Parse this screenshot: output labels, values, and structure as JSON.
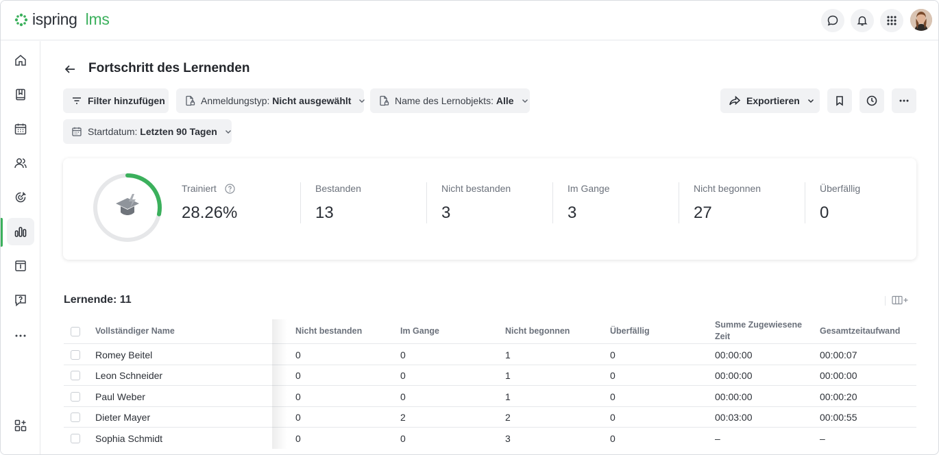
{
  "app": {
    "logo_word1": "ispring",
    "logo_word2": "lms",
    "brand_color": "#3bb05c"
  },
  "header_icons": [
    "chat-icon",
    "bell-icon",
    "apps-grid-icon"
  ],
  "sidebar": {
    "items": [
      {
        "name": "home-icon"
      },
      {
        "name": "book-icon"
      },
      {
        "name": "calendar-icon"
      },
      {
        "name": "users-icon"
      },
      {
        "name": "target-icon"
      },
      {
        "name": "reports-icon",
        "active": true
      },
      {
        "name": "info-calendar-icon"
      },
      {
        "name": "help-icon"
      },
      {
        "name": "more-icon"
      },
      {
        "name": "add-widget-icon"
      }
    ]
  },
  "page": {
    "title": "Fortschritt des Lernenden"
  },
  "filters": {
    "add_filter": "Filter hinzufügen",
    "enrollment_label": "Anmeldungstyp:",
    "enrollment_value": "Nicht ausgewählt",
    "object_label": "Name des Lernobjekts:",
    "object_value": "Alle",
    "start_label": "Startdatum:",
    "start_value": "Letzten 90 Tagen",
    "export": "Exportieren"
  },
  "stats": {
    "progress_fraction": 0.2826,
    "trained_label": "Trainiert",
    "trained_value": "28.26%",
    "items": [
      {
        "label": "Bestanden",
        "value": "13"
      },
      {
        "label": "Nicht bestanden",
        "value": "3"
      },
      {
        "label": "Im Gange",
        "value": "3"
      },
      {
        "label": "Nicht begonnen",
        "value": "27"
      },
      {
        "label": "Überfällig",
        "value": "0"
      }
    ]
  },
  "table": {
    "count_label": "Lernende: 11",
    "columns": {
      "name": "Vollständiger Name",
      "failed": "Nicht bestanden",
      "in_progress": "Im Gange",
      "not_started": "Nicht begonnen",
      "overdue": "Überfällig",
      "assigned_time_1": "Summe Zugewiesene",
      "assigned_time_2": "Zeit",
      "total_time": "Gesamtzeitaufwand"
    },
    "rows": [
      {
        "name": "Romey Beitel",
        "failed": "0",
        "in_progress": "0",
        "not_started": "1",
        "overdue": "0",
        "assigned": "00:00:00",
        "total": "00:00:07"
      },
      {
        "name": "Leon Schneider",
        "failed": "0",
        "in_progress": "0",
        "not_started": "1",
        "overdue": "0",
        "assigned": "00:00:00",
        "total": "00:00:00"
      },
      {
        "name": "Paul Weber",
        "failed": "0",
        "in_progress": "0",
        "not_started": "1",
        "overdue": "0",
        "assigned": "00:00:00",
        "total": "00:00:20"
      },
      {
        "name": "Dieter Mayer",
        "failed": "0",
        "in_progress": "2",
        "not_started": "2",
        "overdue": "0",
        "assigned": "00:03:00",
        "total": "00:00:55"
      },
      {
        "name": "Sophia Schmidt",
        "failed": "0",
        "in_progress": "0",
        "not_started": "3",
        "overdue": "0",
        "assigned": "–",
        "total": "–"
      }
    ]
  }
}
